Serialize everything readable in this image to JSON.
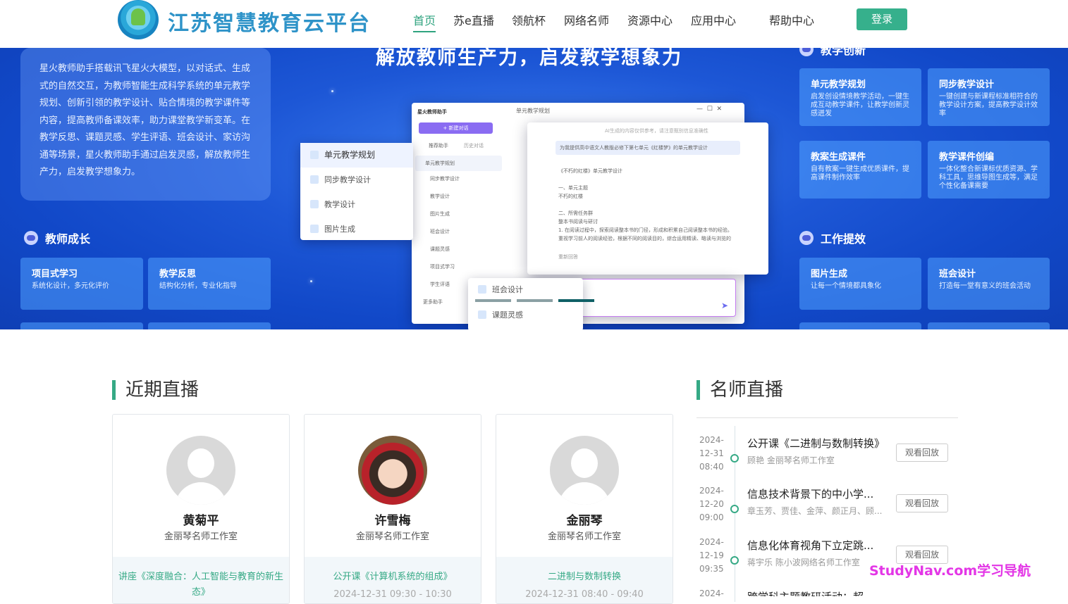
{
  "header": {
    "site_title": "江苏智慧教育云平台",
    "nav": [
      "首页",
      "苏e直播",
      "领航杯",
      "网络名师",
      "资源中心",
      "应用中心",
      "帮助中心"
    ],
    "login": "登录"
  },
  "banner": {
    "slogan": "解放教师生产力，启发教学想象力",
    "description": "星火教师助手搭载讯飞星火大模型，以对话式、生成式的自然交互，为教师智能生成科学系统的单元教学规划、创新引领的教学设计、贴合情境的教学课件等内容，提高教师备课效率，助力课堂教学新变革。在教学反思、课题灵感、学生评语、班会设计、家访沟通等场景，星火教师助手通过启发灵感，解放教师生产力，启发教学想象力。",
    "teacher_growth": {
      "title": "教师成长",
      "items": [
        {
          "name": "项目式学习",
          "desc": "系统化设计，多元化评价"
        },
        {
          "name": "教学反思",
          "desc": "结构化分析，专业化指导"
        }
      ]
    },
    "teaching_innovation": {
      "title": "教学创新",
      "items": [
        {
          "name": "单元教学规划",
          "desc": "启发创设情境教学活动，一键生成互动教学课件，让教学创新灵感迸发"
        },
        {
          "name": "同步教学设计",
          "desc": "一键创建与新课程标准相符合的教学设计方案，提高教学设计效率"
        },
        {
          "name": "教案生成课件",
          "desc": "自有教案一键生成优质课件，提高课件制作效率"
        },
        {
          "name": "教学课件创编",
          "desc": "一体化整合新课标优质资源、学科工具，思维导图生成等，满足个性化备课需要"
        }
      ]
    },
    "work_efficiency": {
      "title": "工作提效",
      "items": [
        {
          "name": "图片生成",
          "desc": "让每一个情境都具象化"
        },
        {
          "name": "班会设计",
          "desc": "打造每一堂有意义的班会活动"
        }
      ]
    },
    "app_preview": {
      "app_name": "星火教师助手",
      "new_chat": "+ 新建对话",
      "tabs": [
        "推荐助手",
        "历史对话"
      ],
      "side_items": [
        "单元教学规划",
        "同步教学设计",
        "教学设计",
        "图片生成",
        "班会设计",
        "课题灵感",
        "项目式学习",
        "学生评语"
      ],
      "more": "更多助手",
      "popup_items": [
        "单元教学规划",
        "同步教学设计",
        "教学设计",
        "图片生成"
      ],
      "bottom_items": [
        "班会设计",
        "课题灵感"
      ],
      "chat_title": "单元教学规划",
      "notice": "AI生成的内容仅供参考，请注意甄别信息准确性",
      "user_msg": "为我提供高中语文人教版必修下第七单元《红楼梦》的单元教学设计",
      "reply_lines": [
        "《不朽的红楼》单元教学设计",
        "一、单元主题",
        "不朽的红楼",
        "二、所需任务群",
        "整本书阅读与研讨",
        "1. 在阅读过程中，探索阅读整本书的门径，形成和积累自己阅读整本书的经验。",
        "重视学习前人的阅读经验，根据不同的阅读目的，综合运用精读、略读与浏览的"
      ],
      "regen": "重新回答"
    }
  },
  "recent_live": {
    "title": "近期直播",
    "cards": [
      {
        "name": "黄菊平",
        "org": "金丽琴名师工作室",
        "title": "讲座《深度融合：人工智能与教育的新生态》",
        "time": ""
      },
      {
        "name": "许雪梅",
        "org": "金丽琴名师工作室",
        "title": "公开课《计算机系统的组成》",
        "time": "2024-12-31 09:30 - 10:30"
      },
      {
        "name": "金丽琴",
        "org": "金丽琴名师工作室",
        "title": "二进制与数制转换",
        "time": "2024-12-31 08:40 - 09:40"
      }
    ]
  },
  "famous_live": {
    "title": "名师直播",
    "items": [
      {
        "date": "2024-12-31",
        "time": "08:40",
        "title": "公开课《二进制与数制转换》",
        "sub": "顾艳 金丽琴名师工作室",
        "btn": "观看回放"
      },
      {
        "date": "2024-12-20",
        "time": "09:00",
        "title": "信息技术背景下的中小学...",
        "sub": "章玉芳、贾佳、金萍、颜正月、顾...",
        "btn": "观看回放"
      },
      {
        "date": "2024-12-19",
        "time": "09:35",
        "title": "信息化体育视角下立定跳...",
        "sub": "蒋宇乐 陈小波网络名师工作室",
        "btn": "观看回放"
      },
      {
        "date": "2024-",
        "time": "",
        "title": "跨学科主题教研活动：超...",
        "sub": "",
        "btn": ""
      }
    ]
  },
  "watermark": "StudyNav.com学习导航"
}
